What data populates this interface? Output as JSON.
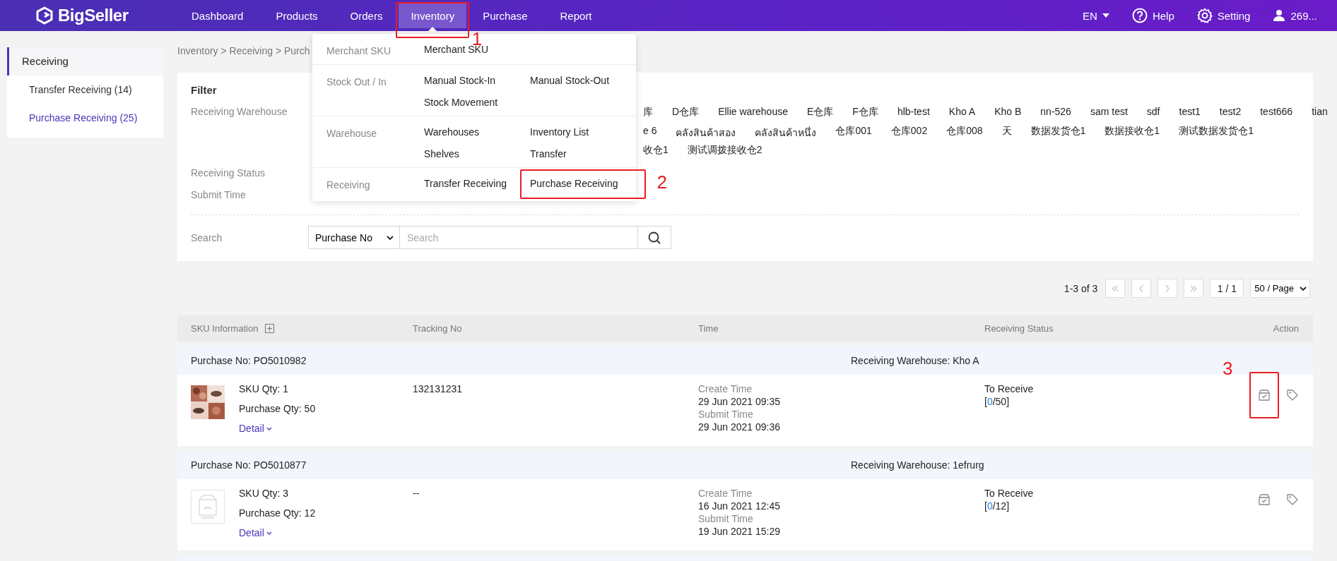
{
  "topbar": {
    "logo": "BigSeller",
    "nav": [
      {
        "label": "Dashboard",
        "selected": false
      },
      {
        "label": "Products",
        "selected": false
      },
      {
        "label": "Orders",
        "selected": false
      },
      {
        "label": "Inventory",
        "selected": true,
        "annotation": "1"
      },
      {
        "label": "Purchase",
        "selected": false
      },
      {
        "label": "Report",
        "selected": false
      }
    ],
    "language": "EN",
    "help": "Help",
    "setting": "Setting",
    "user": "269..."
  },
  "sidebar": {
    "title": "Receiving",
    "items": [
      {
        "label": "Transfer Receiving (14)",
        "selected": false
      },
      {
        "label": "Purchase Receiving (25)",
        "selected": true
      }
    ]
  },
  "breadcrumb": "Inventory > Receiving > Purch",
  "filter": {
    "title": "Filter",
    "labels": [
      "Receiving Warehouse",
      "Receiving Status",
      "Submit Time"
    ],
    "warehouse_rows": [
      [
        "库",
        "D仓库",
        "Ellie warehouse",
        "E仓库",
        "F仓库",
        "hlb-test",
        "Kho A",
        "Kho B",
        "nn-526",
        "sam test",
        "sdf",
        "test1",
        "test2",
        "test666",
        "tian"
      ],
      [
        "e 6",
        "คลังสินค้าสอง",
        "คลังสินค้าหนึ่ง",
        "仓库001",
        "仓库002",
        "仓库008",
        "天",
        "数据发货仓1",
        "数据接收仓1",
        "测试数据发货仓1"
      ],
      [
        "收仓1",
        "测试调拨接收仓2"
      ]
    ],
    "search_label": "Search",
    "search_type": "Purchase No",
    "search": {
      "placeholder": "Search"
    }
  },
  "menu": {
    "sections": [
      {
        "label": "Merchant SKU",
        "items": [
          {
            "label": "Merchant SKU"
          }
        ]
      },
      {
        "label": "Stock Out / In",
        "items": [
          {
            "label": "Manual Stock-In"
          },
          {
            "label": "Manual Stock-Out"
          },
          {
            "label": "Stock Movement"
          }
        ]
      },
      {
        "label": "Warehouse",
        "items": [
          {
            "label": "Warehouses"
          },
          {
            "label": "Inventory List"
          },
          {
            "label": "Shelves"
          },
          {
            "label": "Transfer"
          }
        ]
      },
      {
        "label": "Receiving",
        "items": [
          {
            "label": "Transfer Receiving"
          },
          {
            "label": "Purchase Receiving",
            "annotation": "2"
          }
        ]
      }
    ]
  },
  "pager": {
    "summary": "1-3 of 3",
    "page": "1 / 1",
    "page_size": "50 / Page"
  },
  "table": {
    "columns": [
      "SKU Information",
      "Tracking No",
      "Time",
      "Receiving Status",
      "Action"
    ],
    "rows": [
      {
        "purchase_no": "Purchase No: PO5010982",
        "warehouse": "Receiving Warehouse: Kho A",
        "kind": "picture",
        "sku_qty": "SKU Qty: 1",
        "purchase_qty": "Purchase Qty: 50",
        "detail": "Detail",
        "tracking_no": "132131231",
        "create_label": "Create Time",
        "create_time": "29 Jun 2021 09:35",
        "submit_label": "Submit Time",
        "submit_time": "29 Jun 2021 09:36",
        "status": "To Receive",
        "quantity_parts": [
          {
            "text": "[",
            "highlight": false
          },
          {
            "text": "0",
            "highlight": true
          },
          {
            "text": "/50]",
            "highlight": false
          }
        ],
        "annotation": "3"
      },
      {
        "purchase_no": "Purchase No: PO5010877",
        "warehouse": "Receiving Warehouse: 1efrurg",
        "kind": "no-image",
        "sku_qty": "SKU Qty: 3",
        "purchase_qty": "Purchase Qty: 12",
        "detail": "Detail",
        "tracking_no": "--",
        "create_label": "Create Time",
        "create_time": "16 Jun 2021 12:45",
        "submit_label": "Submit Time",
        "submit_time": "19 Jun 2021 15:29",
        "status": "To Receive",
        "quantity_parts": [
          {
            "text": "[",
            "highlight": false
          },
          {
            "text": "0",
            "highlight": true
          },
          {
            "text": "/12]",
            "highlight": false
          }
        ]
      }
    ]
  }
}
